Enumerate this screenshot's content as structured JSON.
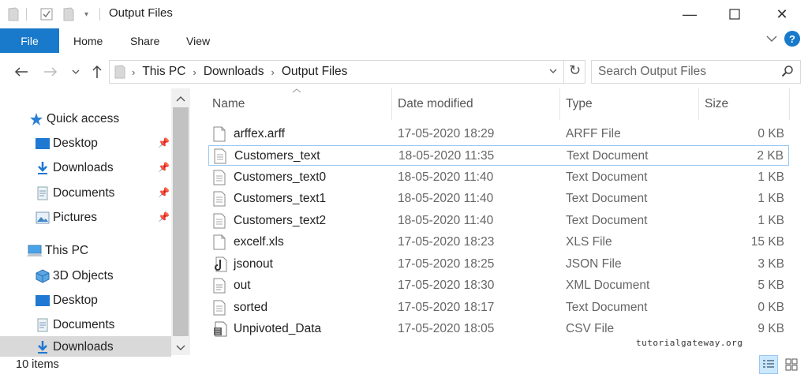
{
  "window": {
    "title": "Output Files",
    "minimize": "—",
    "maximize": "☐",
    "close": "✕"
  },
  "ribbon": {
    "tabs": [
      "File",
      "Home",
      "Share",
      "View"
    ],
    "expand": "∨",
    "help": "?"
  },
  "address": {
    "crumbs": [
      "This PC",
      "Downloads",
      "Output Files"
    ],
    "refresh": "↻"
  },
  "search": {
    "placeholder": "Search Output Files"
  },
  "nav": {
    "quick_access": "Quick access",
    "pinned": [
      "Desktop",
      "Downloads",
      "Documents",
      "Pictures"
    ],
    "this_pc": "This PC",
    "pc_items": [
      "3D Objects",
      "Desktop",
      "Documents",
      "Downloads"
    ]
  },
  "columns": {
    "name": "Name",
    "date": "Date modified",
    "type": "Type",
    "size": "Size"
  },
  "files": [
    {
      "name": "arffex.arff",
      "date": "17-05-2020 18:29",
      "type": "ARFF File",
      "size": "0 KB",
      "icon": "document-icon"
    },
    {
      "name": "Customers_text",
      "date": "18-05-2020 11:35",
      "type": "Text Document",
      "size": "2 KB",
      "icon": "text-file-icon"
    },
    {
      "name": "Customers_text0",
      "date": "18-05-2020 11:40",
      "type": "Text Document",
      "size": "1 KB",
      "icon": "text-file-icon"
    },
    {
      "name": "Customers_text1",
      "date": "18-05-2020 11:40",
      "type": "Text Document",
      "size": "1 KB",
      "icon": "text-file-icon"
    },
    {
      "name": "Customers_text2",
      "date": "18-05-2020 11:40",
      "type": "Text Document",
      "size": "1 KB",
      "icon": "text-file-icon"
    },
    {
      "name": "excelf.xls",
      "date": "17-05-2020 18:23",
      "type": "XLS File",
      "size": "15 KB",
      "icon": "document-icon"
    },
    {
      "name": "jsonout",
      "date": "17-05-2020 18:25",
      "type": "JSON File",
      "size": "3 KB",
      "icon": "json-file-icon"
    },
    {
      "name": "out",
      "date": "17-05-2020 18:30",
      "type": "XML Document",
      "size": "5 KB",
      "icon": "xml-file-icon"
    },
    {
      "name": "sorted",
      "date": "17-05-2020 18:17",
      "type": "Text Document",
      "size": "0 KB",
      "icon": "text-file-icon"
    },
    {
      "name": "Unpivoted_Data",
      "date": "17-05-2020 18:05",
      "type": "CSV File",
      "size": "9 KB",
      "icon": "csv-file-icon"
    }
  ],
  "status": {
    "count": "10 items",
    "watermark": "tutorialgateway.org"
  },
  "colors": {
    "accent": "#1979ca",
    "selection_border": "#99c8f2",
    "selection_fill": "#cce8ff"
  }
}
